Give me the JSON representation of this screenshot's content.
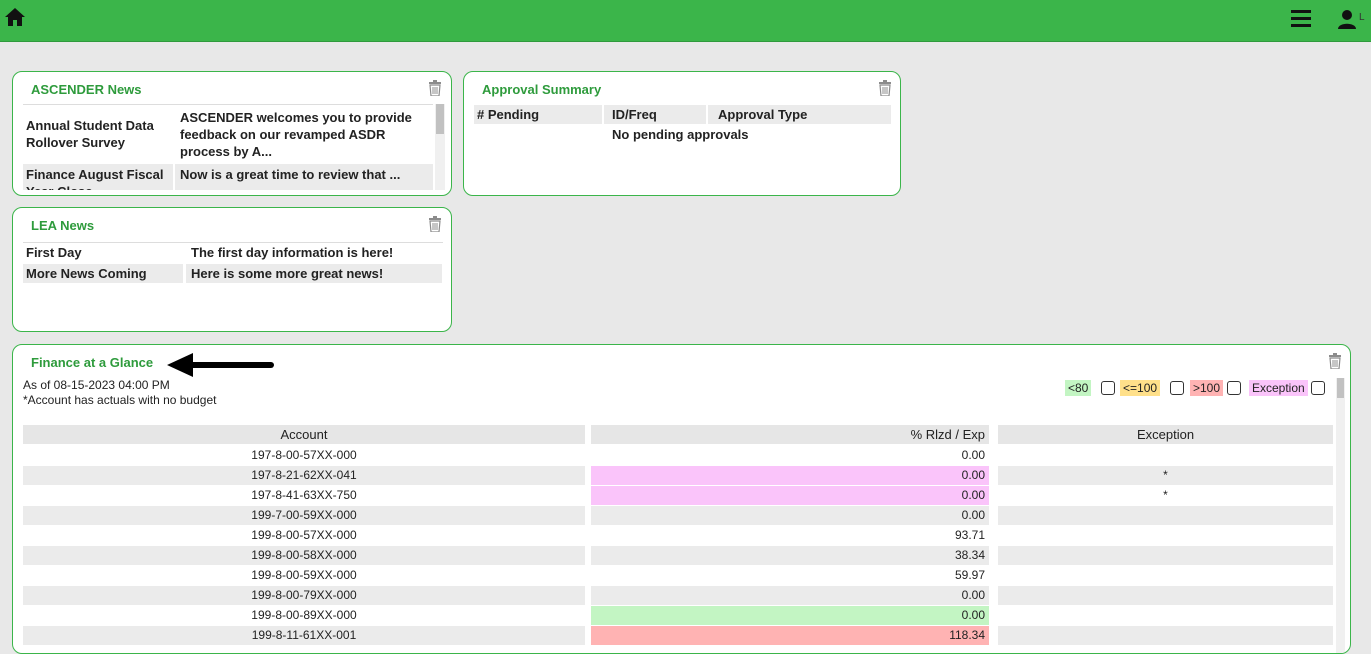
{
  "header": {
    "user_initial": "L"
  },
  "ascender_news": {
    "title": "ASCENDER News",
    "items": [
      {
        "title": "Annual Student Data Rollover Survey",
        "body": "ASCENDER welcomes you to provide feedback on our revamped ASDR process by A..."
      },
      {
        "title": "Finance August Fiscal Year Close",
        "body": "Now is a great time to review that ..."
      }
    ]
  },
  "approval_summary": {
    "title": "Approval Summary",
    "columns": [
      "# Pending",
      "ID/Freq",
      "Approval Type"
    ],
    "empty_message": "No pending approvals"
  },
  "lea_news": {
    "title": "LEA News",
    "items": [
      {
        "title": "First Day",
        "body": "The first day information is here!"
      },
      {
        "title": "More News Coming",
        "body": "Here is some more great news!"
      }
    ]
  },
  "finance": {
    "title": "Finance at a Glance",
    "as_of": "As of 08-15-2023 04:00 PM",
    "note": "*Account has actuals with no budget",
    "legend": [
      {
        "label": "<80",
        "color": "#c3f5c3"
      },
      {
        "label": "<=100",
        "color": "#ffe08a"
      },
      {
        "label": ">100",
        "color": "#ffb3b3"
      },
      {
        "label": "Exception",
        "color": "#fac4fa"
      }
    ],
    "columns": [
      "Account",
      "% Rlzd / Exp",
      "Exception"
    ],
    "rows": [
      {
        "account": "197-8-00-57XX-000",
        "pct": "0.00",
        "exception": "",
        "status": "none"
      },
      {
        "account": "197-8-21-62XX-041",
        "pct": "0.00",
        "exception": "*",
        "status": "exception"
      },
      {
        "account": "197-8-41-63XX-750",
        "pct": "0.00",
        "exception": "*",
        "status": "exception"
      },
      {
        "account": "199-7-00-59XX-000",
        "pct": "0.00",
        "exception": "",
        "status": "none"
      },
      {
        "account": "199-8-00-57XX-000",
        "pct": "93.71",
        "exception": "",
        "status": "none"
      },
      {
        "account": "199-8-00-58XX-000",
        "pct": "38.34",
        "exception": "",
        "status": "none"
      },
      {
        "account": "199-8-00-59XX-000",
        "pct": "59.97",
        "exception": "",
        "status": "none"
      },
      {
        "account": "199-8-00-79XX-000",
        "pct": "0.00",
        "exception": "",
        "status": "none"
      },
      {
        "account": "199-8-00-89XX-000",
        "pct": "0.00",
        "exception": "",
        "status": "low"
      },
      {
        "account": "199-8-11-61XX-001",
        "pct": "118.34",
        "exception": "",
        "status": "over"
      }
    ],
    "status_colors": {
      "none": "",
      "low": "#c3f5c3",
      "over": "#ffb3b3",
      "exception": "#fac4fa"
    }
  }
}
